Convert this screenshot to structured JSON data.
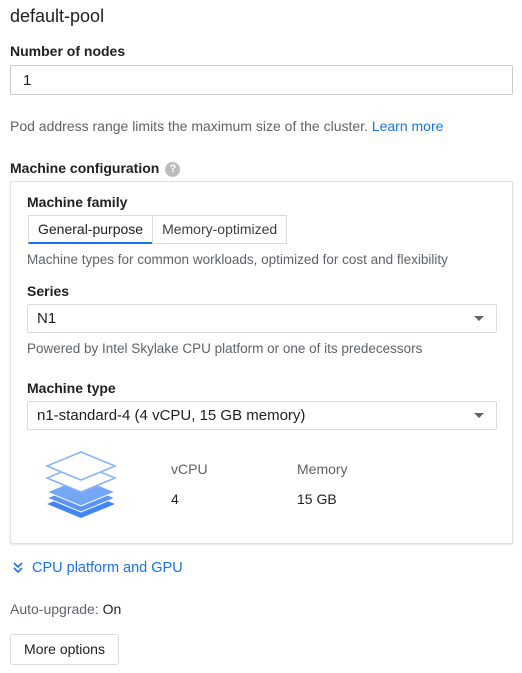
{
  "pool": {
    "title": "default-pool",
    "nodes_label": "Number of nodes",
    "nodes_value": "1",
    "pod_range_text": "Pod address range limits the maximum size of the cluster.",
    "learn_more": "Learn more"
  },
  "machine_config": {
    "heading": "Machine configuration",
    "help_glyph": "?",
    "family_label": "Machine family",
    "family_tabs": [
      "General-purpose",
      "Memory-optimized"
    ],
    "family_selected": "General-purpose",
    "family_desc": "Machine types for common workloads, optimized for cost and flexibility",
    "series_label": "Series",
    "series_value": "N1",
    "series_desc": "Powered by Intel Skylake CPU platform or one of its predecessors",
    "type_label": "Machine type",
    "type_value": "n1-standard-4 (4 vCPU, 15 GB memory)",
    "vcpu_label": "vCPU",
    "vcpu_value": "4",
    "memory_label": "Memory",
    "memory_value": "15 GB"
  },
  "cpu_platform_link": "CPU platform and GPU",
  "auto_upgrade": {
    "label": "Auto-upgrade:",
    "value": "On"
  },
  "more_options": "More options",
  "colors": {
    "accent": "#1a73e8",
    "stack_icon": "#4285f4"
  }
}
